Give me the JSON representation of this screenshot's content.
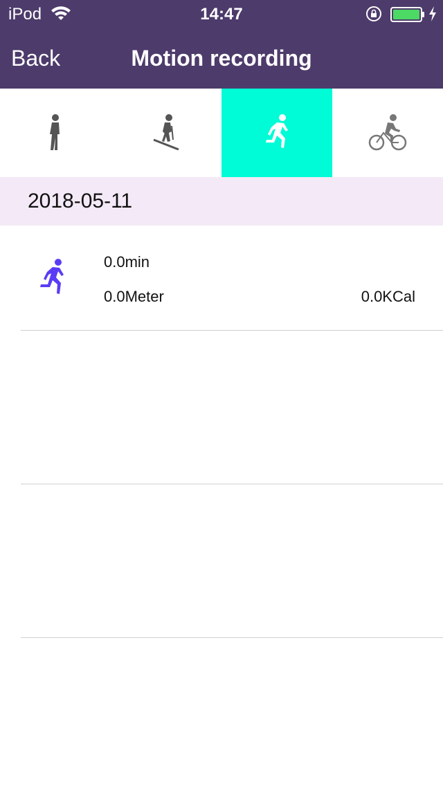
{
  "status_bar": {
    "carrier": "iPod",
    "time": "14:47",
    "wifi_icon": "wifi-icon",
    "lock_icon": "rotation-lock-icon",
    "battery_icon": "battery-icon",
    "charging_icon": "charging-bolt-icon",
    "battery_color": "#4cd964"
  },
  "nav": {
    "back_label": "Back",
    "title": "Motion recording",
    "background": "#4d3b6b"
  },
  "tabs": [
    {
      "icon": "walking-icon",
      "active": false
    },
    {
      "icon": "skiing-icon",
      "active": false
    },
    {
      "icon": "running-icon",
      "active": true
    },
    {
      "icon": "cycling-icon",
      "active": false
    }
  ],
  "active_tab_color": "#00fcd6",
  "date": "2018-05-11",
  "records": [
    {
      "icon": "running-icon",
      "icon_color": "#5b3cf5",
      "duration": "0.0min",
      "distance": "0.0Meter",
      "calories": "0.0KCal"
    }
  ]
}
